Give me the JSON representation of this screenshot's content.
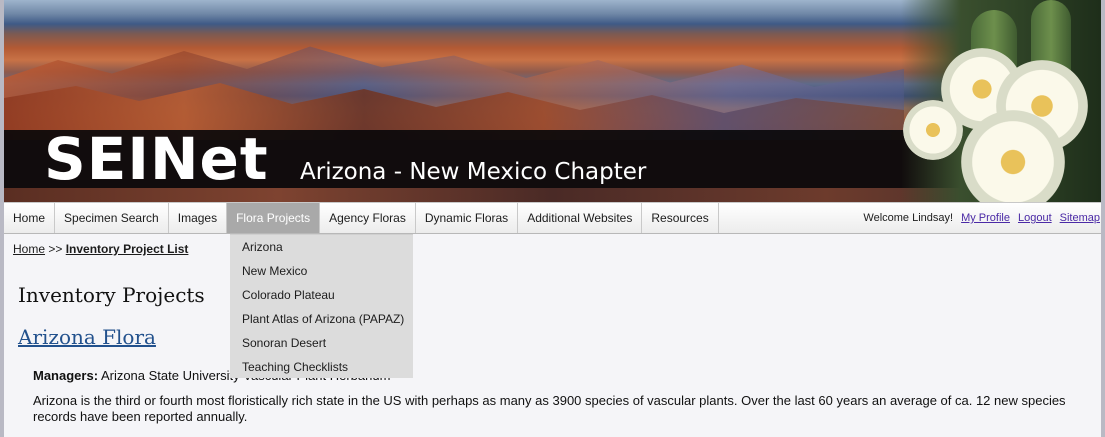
{
  "banner": {
    "logo_text": "SEINet",
    "chapter_text": "Arizona - New Mexico Chapter"
  },
  "nav": {
    "items": [
      {
        "label": "Home"
      },
      {
        "label": "Specimen Search"
      },
      {
        "label": "Images"
      },
      {
        "label": "Flora Projects"
      },
      {
        "label": "Agency Floras"
      },
      {
        "label": "Dynamic Floras"
      },
      {
        "label": "Additional Websites"
      },
      {
        "label": "Resources"
      }
    ],
    "active": "Flora Projects",
    "welcome": "Welcome Lindsay!",
    "links": [
      {
        "label": "My Profile"
      },
      {
        "label": "Logout"
      },
      {
        "label": "Sitemap"
      }
    ]
  },
  "dropdown": {
    "items": [
      {
        "label": "Arizona"
      },
      {
        "label": "New Mexico"
      },
      {
        "label": "Colorado Plateau"
      },
      {
        "label": "Plant Atlas of Arizona (PAPAZ)"
      },
      {
        "label": "Sonoran Desert"
      },
      {
        "label": "Teaching Checklists"
      }
    ]
  },
  "breadcrumb": {
    "home": "Home",
    "separator": ">>",
    "current": "Inventory Project List"
  },
  "main": {
    "page_title": "Inventory Projects",
    "project_title": "Arizona Flora",
    "managers_label": "Managers:",
    "managers_value": "Arizona State University Vascular Plant Herbarium",
    "description": "Arizona is the third or fourth most floristically rich state in the US with perhaps as many as 3900 species of vascular plants. Over the last 60 years an average of ca. 12 new species records have been reported annually."
  },
  "colors": {
    "link": "#4b2aa6",
    "project_link": "#22518d",
    "active_nav": "#a9a9a9",
    "dropdown_bg": "#dcdcdc"
  }
}
